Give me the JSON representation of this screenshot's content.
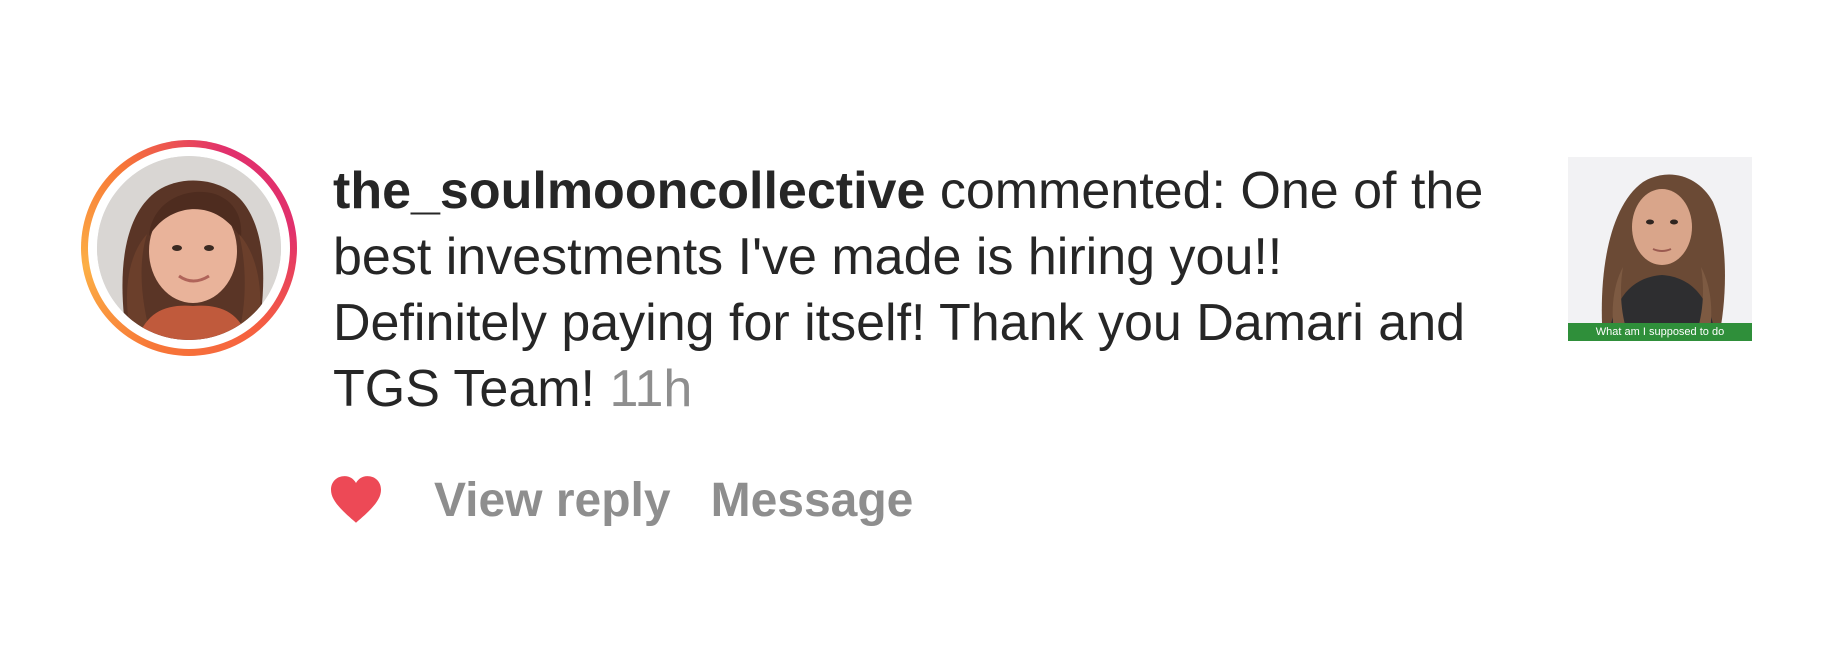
{
  "notification": {
    "username": "the_soulmooncollective",
    "action_text": " commented: One of the best investments I've made is hiring you!! Definitely paying for itself! Thank you Damari and TGS Team! ",
    "timestamp": "11h",
    "avatar_icon": "profile-photo",
    "ring_colors": [
      "#fcaf45",
      "#f77737",
      "#e1306c"
    ]
  },
  "actions": {
    "like_icon": "heart-icon",
    "like_color": "#ed4956",
    "view_reply_label": "View reply",
    "message_label": "Message"
  },
  "post_thumbnail": {
    "caption": "What am I supposed to do",
    "caption_color": "#2f8f3a"
  }
}
